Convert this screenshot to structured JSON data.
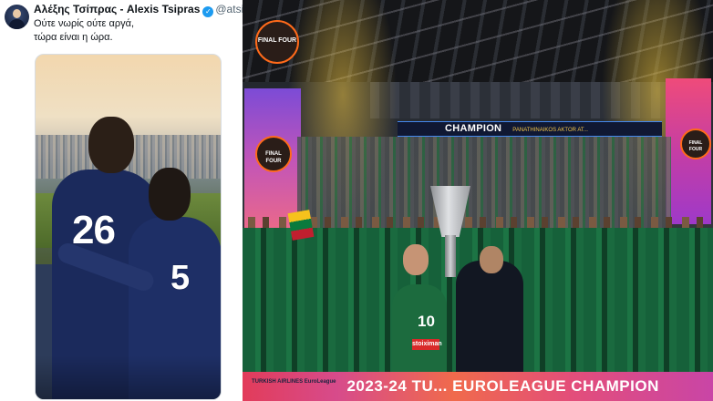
{
  "tweet": {
    "display_name": "Αλέξης Τσίπρας - Alexis Tsipras",
    "verified_mark": "✓",
    "handle": "@atsipras",
    "text_lines": [
      "Ούτε νωρίς ούτε αργά,",
      "τώρα είναι η ώρα."
    ],
    "photo": {
      "jersey_numbers": [
        "26",
        "5"
      ]
    }
  },
  "celebration_photo": {
    "final_four_logo": "FINAL FOUR",
    "ribbon": {
      "champion": "CHAMPION",
      "team": "PANATHINAIKOS AKTOR AT..."
    },
    "captain_number": "10",
    "sponsor": "stoiximan",
    "board": {
      "logo": "TURKISH AIRLINES EuroLeague",
      "text": "2023-24 TU... EUROLEAGUE CHAMPION"
    }
  },
  "icons": [
    "avatar",
    "verified-badge-icon",
    "final-four-logo-icon"
  ],
  "colors": {
    "verified_blue": "#1d9bf0",
    "jersey_navy": "#1b2a5c",
    "team_green": "#1c6b3e",
    "board_pink": "#e23c5a"
  }
}
